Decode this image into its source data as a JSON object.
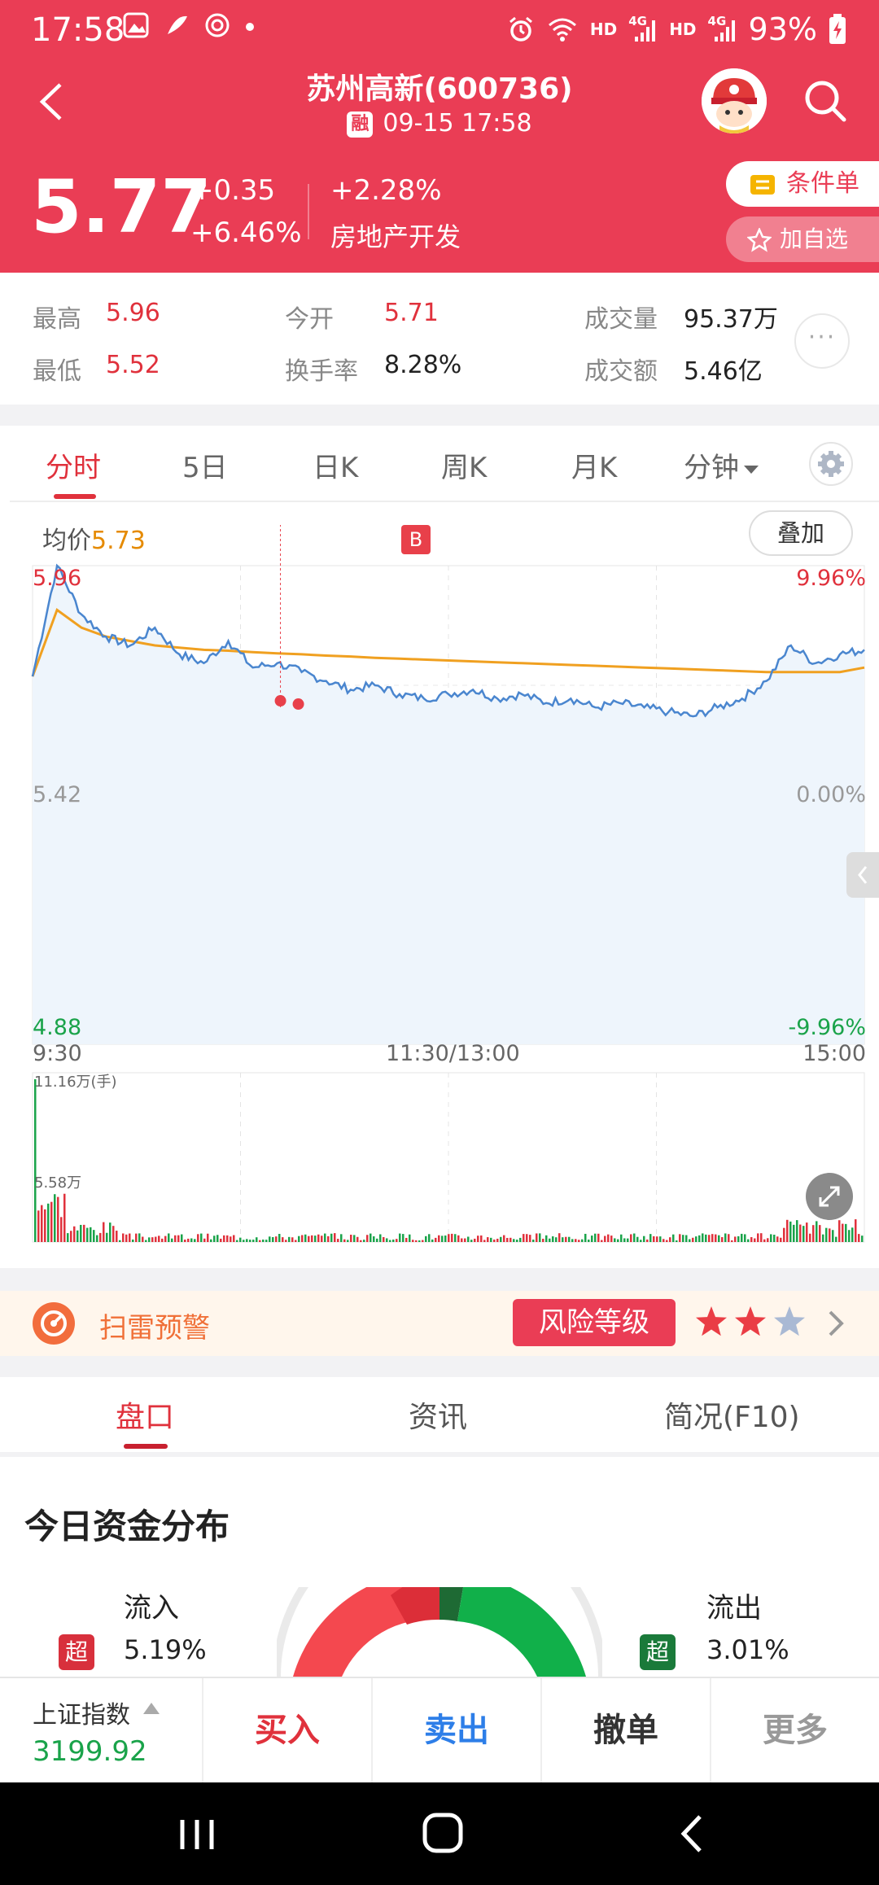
{
  "status_bar": {
    "time": "17:58",
    "hd1": "HD",
    "hd2": "HD",
    "net1": "4G",
    "net2": "4G",
    "battery": "93%"
  },
  "header": {
    "title": "苏州高新(600736)",
    "rong_badge": "融",
    "datetime": "09-15 17:58",
    "price": "5.77",
    "change": "+0.35",
    "change_pct": "+6.46%",
    "sector_change": "+2.28%",
    "sector": "房地产开发",
    "condition_order_label": "条件单",
    "add_favorite_label": "加自选"
  },
  "stats": {
    "high_label": "最高",
    "high": "5.96",
    "low_label": "最低",
    "low": "5.52",
    "open_label": "今开",
    "open": "5.71",
    "turnover_label": "换手率",
    "turnover": "8.28%",
    "volume_label": "成交量",
    "volume": "95.37万",
    "amount_label": "成交额",
    "amount": "5.46亿",
    "more_label": "···"
  },
  "chart_tabs": [
    "分时",
    "5日",
    "日K",
    "周K",
    "月K",
    "分钟"
  ],
  "chart": {
    "avg_label": "均价",
    "avg_value": "5.73",
    "overlay_label": "叠加",
    "trade_marker": "B",
    "y_max_label": "5.96",
    "y_mid_label": "5.42",
    "y_min_label": "4.88",
    "pct_max_label": "9.96%",
    "pct_mid_label": "0.00%",
    "pct_min_label": "-9.96%",
    "x_labels": [
      "9:30",
      "11:30/13:00",
      "15:00"
    ],
    "vol_max_label": "11.16万(手)",
    "vol_mid_label": "5.58万"
  },
  "chart_data": {
    "type": "line",
    "x": [
      "9:30",
      "11:30/13:00",
      "15:00"
    ],
    "ylim": [
      4.88,
      5.96
    ],
    "grid": true,
    "series": [
      {
        "values": [
          5.71,
          5.96,
          5.85,
          5.8,
          5.78,
          5.82,
          5.76,
          5.74,
          5.79,
          5.73,
          5.74,
          5.72,
          5.7,
          5.68,
          5.69,
          5.67,
          5.66,
          5.67,
          5.68,
          5.66,
          5.67,
          5.65,
          5.66,
          5.64,
          5.65,
          5.64,
          5.63,
          5.62,
          5.64,
          5.66,
          5.7,
          5.78,
          5.74,
          5.76,
          5.77
        ]
      },
      {
        "values": [
          5.71,
          5.86,
          5.82,
          5.8,
          5.79,
          5.78,
          5.775,
          5.77,
          5.768,
          5.765,
          5.762,
          5.76,
          5.757,
          5.755,
          5.752,
          5.75,
          5.748,
          5.746,
          5.744,
          5.742,
          5.74,
          5.738,
          5.736,
          5.734,
          5.732,
          5.73,
          5.728,
          5.726,
          5.724,
          5.722,
          5.72,
          5.72,
          5.72,
          5.72,
          5.73
        ]
      }
    ]
  },
  "alert": {
    "label": "扫雷预警",
    "risk_label": "风险等级",
    "risk_stars": 2,
    "max_stars": 3
  },
  "bottom_tabs": [
    "盘口",
    "资讯",
    "简况(F10)"
  ],
  "fund_flow": {
    "title": "今日资金分布",
    "inflow_label": "流入",
    "inflow_badge": "超",
    "inflow_value": "5.19%",
    "outflow_label": "流出",
    "outflow_badge": "超",
    "outflow_value": "3.01%"
  },
  "footer": {
    "index_name": "上证指数",
    "index_value": "3199.92",
    "buy": "买入",
    "sell": "卖出",
    "cancel": "撤单",
    "more": "更多"
  },
  "colors": {
    "brand": "#ea3d55",
    "up": "#e0313c",
    "down": "#1aa34a",
    "avg": "#f0a020",
    "price_line": "#4a86cf"
  }
}
